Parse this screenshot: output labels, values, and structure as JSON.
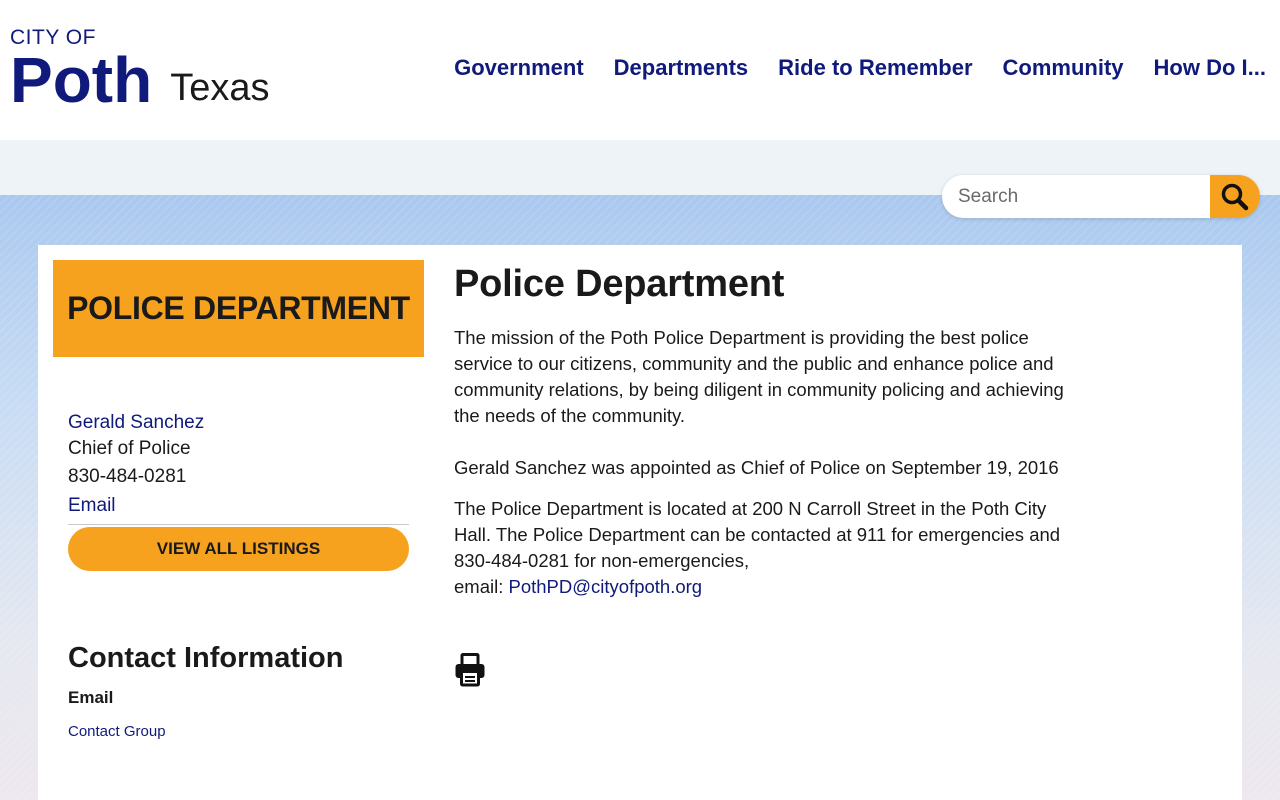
{
  "header": {
    "logo": {
      "city_of": "CITY OF",
      "name": "Poth",
      "state": "Texas"
    },
    "nav": [
      "Government",
      "Departments",
      "Ride to Remember",
      "Community",
      "How Do I..."
    ]
  },
  "search": {
    "placeholder": "Search",
    "icon": "search-icon"
  },
  "sidebar": {
    "banner": "POLICE DEPARTMENT",
    "contact": {
      "name": "Gerald Sanchez",
      "title": "Chief of Police",
      "phone": "830-484-0281",
      "email_label": "Email"
    },
    "view_all_button": "VIEW ALL LISTINGS",
    "contact_info": {
      "heading": "Contact Information",
      "email_label": "Email",
      "link": "Contact Group"
    }
  },
  "main": {
    "title": "Police Department",
    "paragraph1": "The mission of the Poth Police Department is providing the best police service to our citizens, community and the public and enhance police and community relations, by being diligent in community policing and achieving the needs of the community.",
    "paragraph2": "Gerald Sanchez was appointed as Chief of Police on September 19, 2016",
    "paragraph3_text": "The Police Department is located at 200 N Carroll Street in the  Poth City Hall.  The Police Department can be contacted at 911 for emergencies and 830-484-0281 for non-emergencies,",
    "paragraph3_email_prefix": "email: ",
    "paragraph3_email": "PothPD@cityofpoth.org",
    "print_icon": "print-icon"
  },
  "colors": {
    "brand_navy": "#0f1a7a",
    "accent_orange": "#f6a21e"
  }
}
